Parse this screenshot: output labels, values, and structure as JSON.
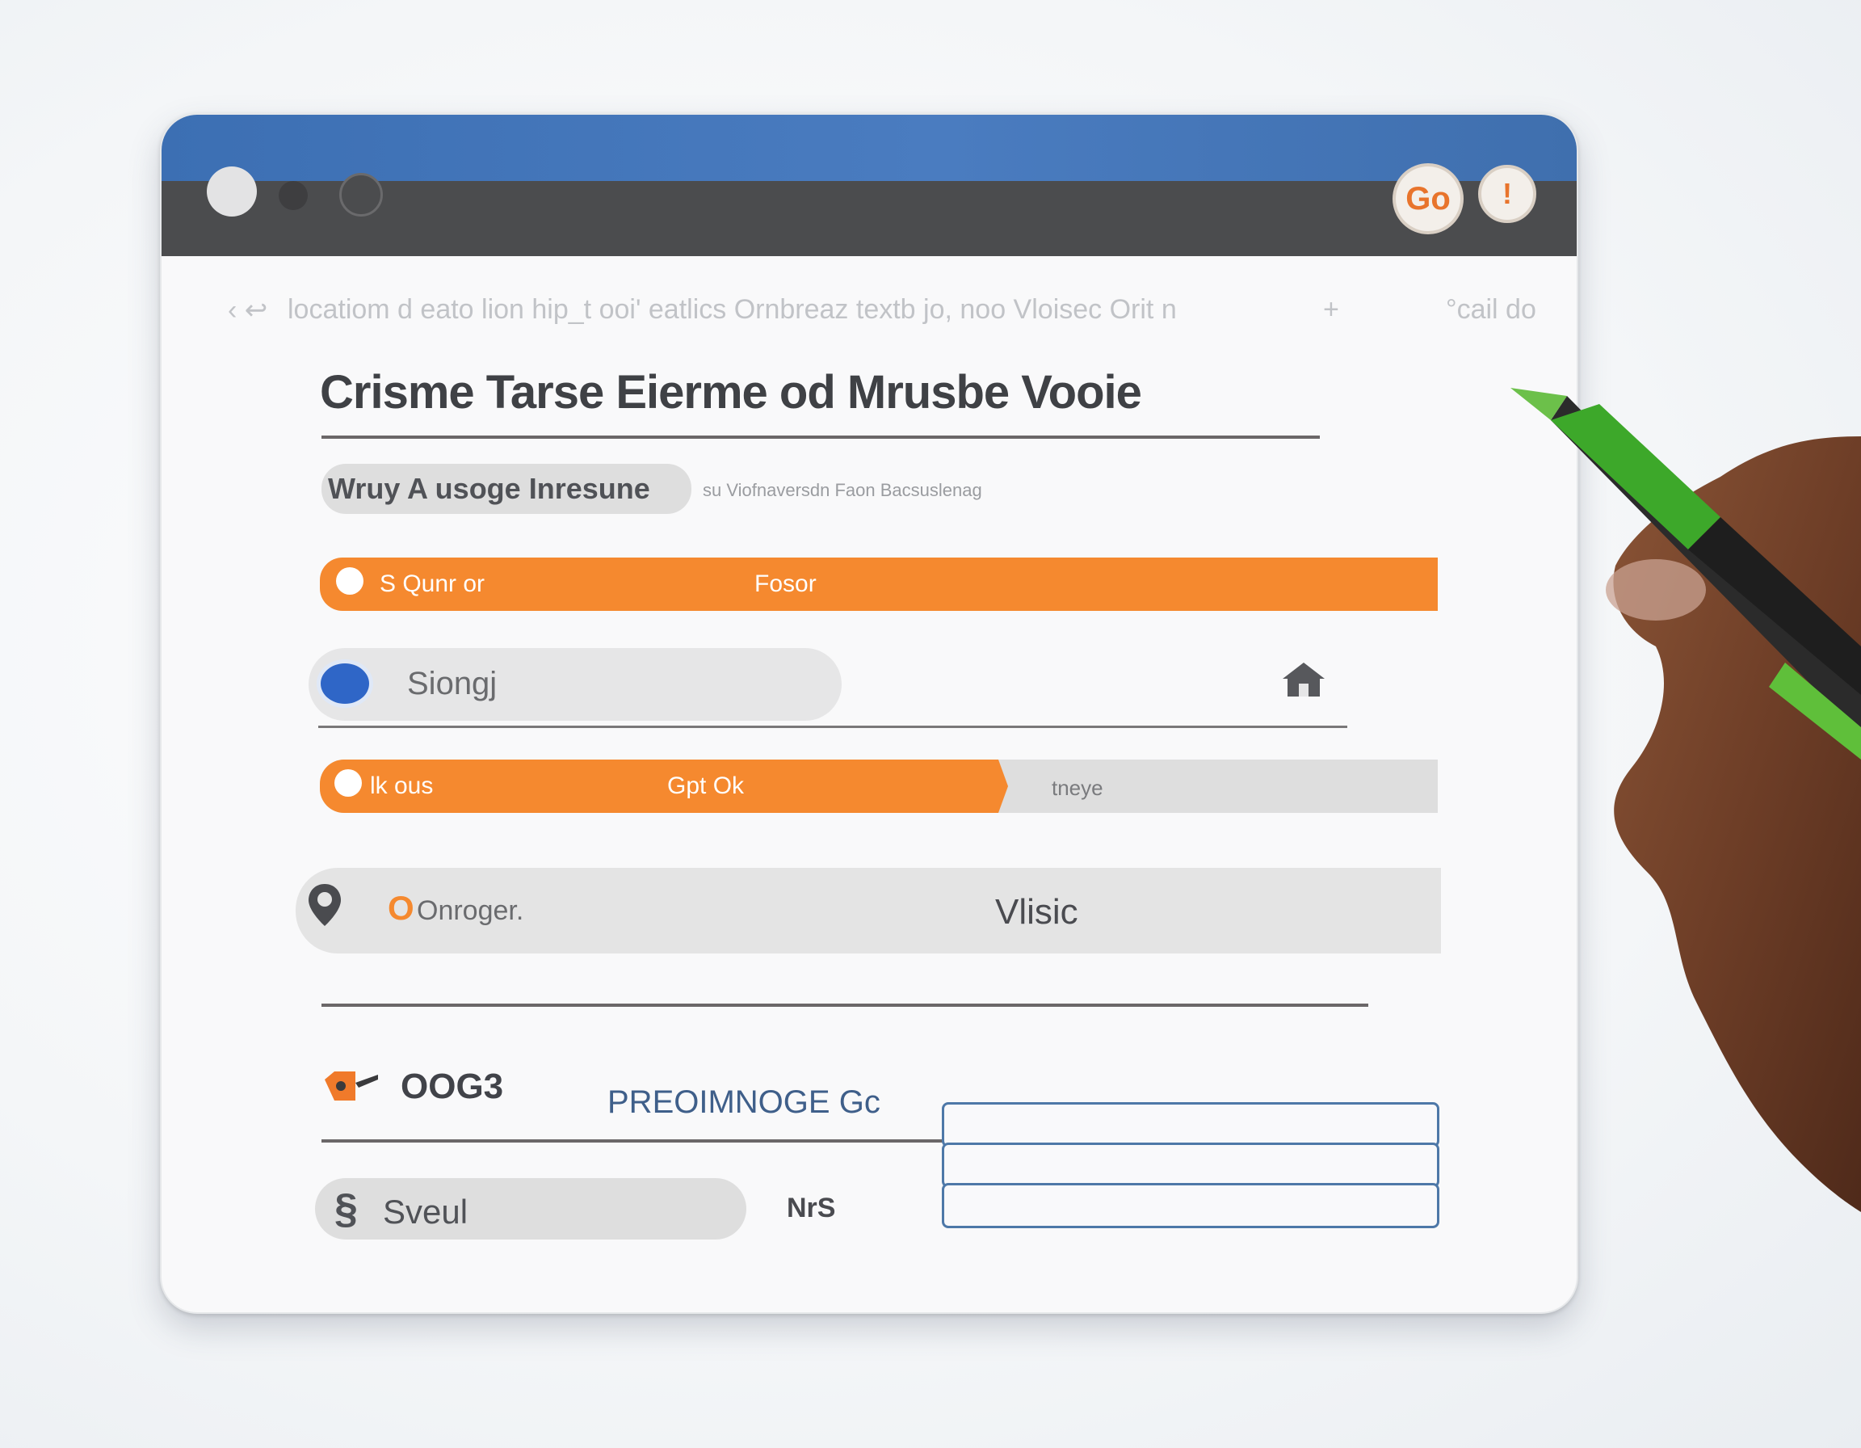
{
  "window": {
    "url_text": "locatiom d  eato lion hip_t ooi' eatlics Ornbreaz textb jo, noo Vloisec Orit n",
    "url_right_text": "°cail do",
    "header_icons": [
      "orange-badge-icon",
      "alert-badge-icon"
    ],
    "header_badge_text": "Go"
  },
  "form": {
    "title": "Crisme  Tarse Eierme od Mrusbe Vooie",
    "subtitle_pill": "Wruy A usoge Inresune",
    "subtitle_note": "su Viofnaversdn Faon Bacsuslenag",
    "progress_bar_1": {
      "left_label": "S Qunr or",
      "center_label": "Fosor",
      "fill": 1.0
    },
    "search": {
      "value": "Siongj",
      "icon": "globe-icon",
      "right_icon": "home-icon"
    },
    "progress_bar_2": {
      "left_label": "lk ous",
      "center_label": "Gpt Ok",
      "right_label": "tneye",
      "fill": 0.62
    },
    "location_row": {
      "left_label": "Onroger.",
      "center_label": "Vlisic",
      "icon": "map-pin-icon"
    },
    "footer": {
      "section_title": "OOG3",
      "section_subtitle": "PREOIMNOGE Gc",
      "pill_label": "Sveul",
      "side_label": "NrS",
      "stacked_fields": [
        "",
        "",
        ""
      ]
    }
  },
  "colors": {
    "accent_orange": "#f5892f",
    "header_blue": "#3c6fb3",
    "header_dark": "#4b4c4e",
    "field_border_blue": "#4e78a8"
  }
}
